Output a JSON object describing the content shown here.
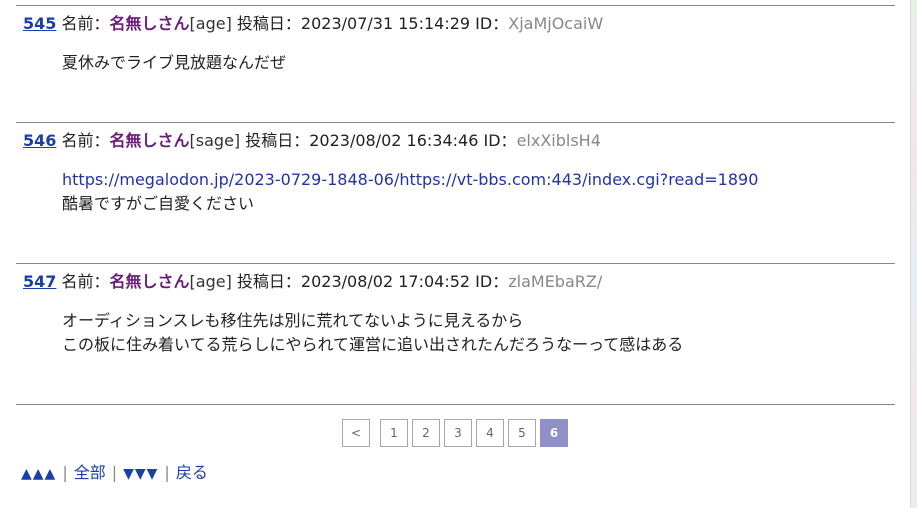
{
  "posts": [
    {
      "number": "545",
      "name_label": "名前：",
      "author": "名無しさん",
      "mail": "[age]",
      "date_label": " 投稿日：",
      "date": "2023/07/31 15:14:29",
      "id_label": " ID：",
      "uid": "XjaMjOcaiW",
      "lines": [
        "夏休みでライブ見放題なんだぜ"
      ]
    },
    {
      "number": "546",
      "name_label": "名前：",
      "author": "名無しさん",
      "mail": "[sage]",
      "date_label": " 投稿日：",
      "date": "2023/08/02 16:34:46",
      "id_label": " ID：",
      "uid": "elxXiblsH4",
      "link": "https://megalodon.jp/2023-0729-1848-06/https://vt-bbs.com:443/index.cgi?read=1890",
      "lines": [
        "酷暑ですがご自愛ください"
      ]
    },
    {
      "number": "547",
      "name_label": "名前：",
      "author": "名無しさん",
      "mail": "[age]",
      "date_label": " 投稿日：",
      "date": "2023/08/02 17:04:52",
      "id_label": " ID：",
      "uid": "zlaMEbaRZ/",
      "lines": [
        "オーディションスレも移住先は別に荒れてないように見えるから",
        "この板に住み着いてる荒らしにやられて運営に追い出されたんだろうなーって感はある"
      ]
    }
  ],
  "pager": {
    "prev": "<",
    "pages": [
      "1",
      "2",
      "3",
      "4",
      "5",
      "6"
    ],
    "current": "6"
  },
  "footer": {
    "top_arrows": "▲▲▲",
    "all": "全部",
    "bottom_arrows": "▼▼▼",
    "back": "戻る",
    "separator": "|"
  }
}
